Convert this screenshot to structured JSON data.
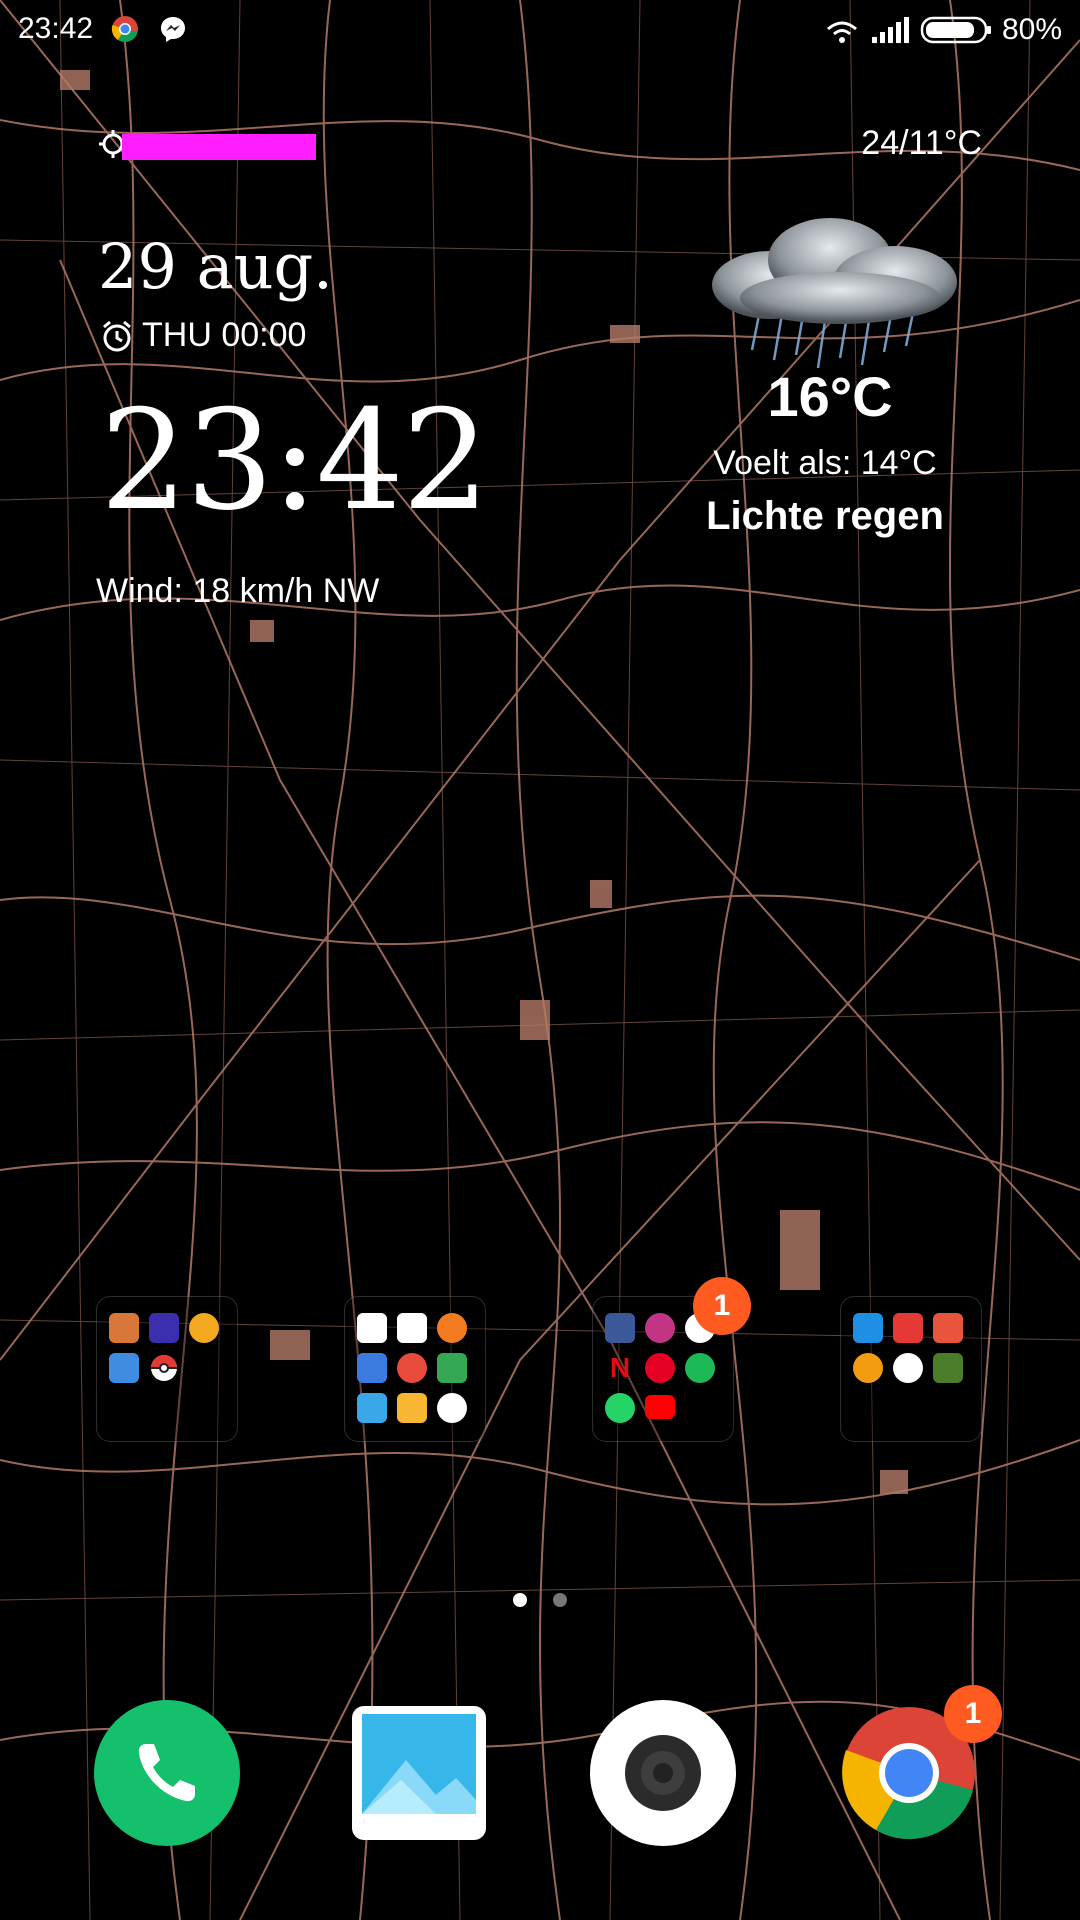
{
  "status_bar": {
    "time": "23:42",
    "battery_percent": "80%",
    "notification_icons": [
      "chrome-icon",
      "messenger-icon"
    ],
    "system_icons": [
      "wifi-icon",
      "signal-icon",
      "battery-icon"
    ]
  },
  "widget": {
    "location_label_redacted": true,
    "date": "29 aug.",
    "alarm": "THU 00:00",
    "time": "23:42",
    "wind": "Wind: 18 km/h NW",
    "temp_range": "24/11°C",
    "weather_icon": "rain-cloud-icon",
    "temperature": "16°C",
    "feels_like": "Voelt als: 14°C",
    "condition": "Lichte regen"
  },
  "folders": [
    {
      "name": "games-folder",
      "icons": [
        "game-1-icon",
        "game-2-icon",
        "game-3-icon",
        "game-4-icon",
        "pokeball-icon"
      ]
    },
    {
      "name": "tools-folder",
      "icons": [
        "calculator-icon",
        "compass-icon",
        "equals-icon",
        "calendar-icon",
        "lifesaver-icon",
        "maps-icon",
        "mail-icon",
        "notes-icon",
        "nos-icon"
      ]
    },
    {
      "name": "social-folder",
      "badge": "1",
      "icons": [
        "facebook-icon",
        "instagram-icon",
        "messenger-icon",
        "netflix-icon",
        "pinterest-icon",
        "spotify-icon",
        "whatsapp-icon",
        "youtube-icon"
      ]
    },
    {
      "name": "shopping-folder",
      "icons": [
        "appie-icon",
        "discount-icon",
        "mailbox-icon",
        "hand-icon",
        "brand-icon",
        "mcdonalds-icon"
      ]
    }
  ],
  "page_indicator": {
    "pages": 2,
    "current": 1
  },
  "dock": [
    {
      "name": "phone-app",
      "icon": "phone-icon"
    },
    {
      "name": "gallery-app",
      "icon": "gallery-icon"
    },
    {
      "name": "camera-app",
      "icon": "camera-icon"
    },
    {
      "name": "chrome-app",
      "icon": "chrome-icon",
      "badge": "1"
    }
  ],
  "colors": {
    "road": "#b47a68",
    "badge": "#ff5a1f",
    "phone_green": "#15c06c",
    "redaction": "#ff1eff"
  }
}
